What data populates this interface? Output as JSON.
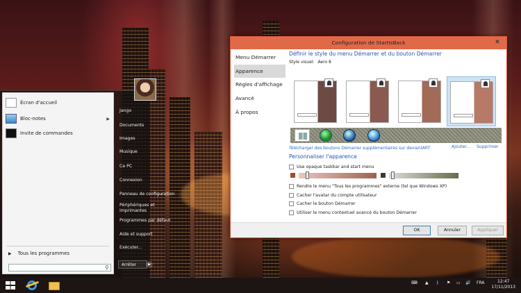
{
  "start_menu": {
    "programs": [
      {
        "label": "Écran d'accueil",
        "icon": "start-screen-icon"
      },
      {
        "label": "Bloc-notes",
        "icon": "notepad-icon",
        "has_submenu": true
      },
      {
        "label": "Invite de commandes",
        "icon": "cmd-icon"
      }
    ],
    "all_programs": "Tous les programmes",
    "search_placeholder": "",
    "right_links": [
      "Jango",
      "Documents",
      "Images",
      "Musique",
      "Ce PC",
      "Connexion",
      "Panneau de configuration",
      "Périphériques et\nimprimantes",
      "Programmes par défaut",
      "Aide et support",
      "Exécuter..."
    ],
    "shutdown": "Arrêter"
  },
  "window": {
    "title": "Configuration de StartIsBack",
    "close": "✕",
    "nav": [
      "Menu Démarrer",
      "Apparence",
      "Règles d'affichage",
      "Avancé",
      "À propos"
    ],
    "nav_selected": 1,
    "heading": "Définir le style du menu Démarrer et du bouton Démarrer",
    "style_label": "Style visuel:",
    "style_value": "Aero 8",
    "download_link": "Télécharger des boutons Démarrer supplémentaires sur deviantART",
    "add_link": "Ajouter...",
    "remove_link": "Supprimer",
    "personalize_heading": "Personnaliser l'apparence",
    "opaque_option": "Use opaque taskbar and start menu",
    "options": [
      "Rendre le menu \"Tous les programmes\" externe (tel que Windows XP)",
      "Cacher l'avatar du compte utilisateur",
      "Cacher le bouton Démarrer",
      "Utiliser le menu contextuel avancé du bouton Démarrer"
    ],
    "ok": "OK",
    "cancel": "Annuler",
    "apply": "Appliquer"
  },
  "taskbar": {
    "lang": "FRA",
    "time": "12:47",
    "date": "17/11/2013"
  }
}
